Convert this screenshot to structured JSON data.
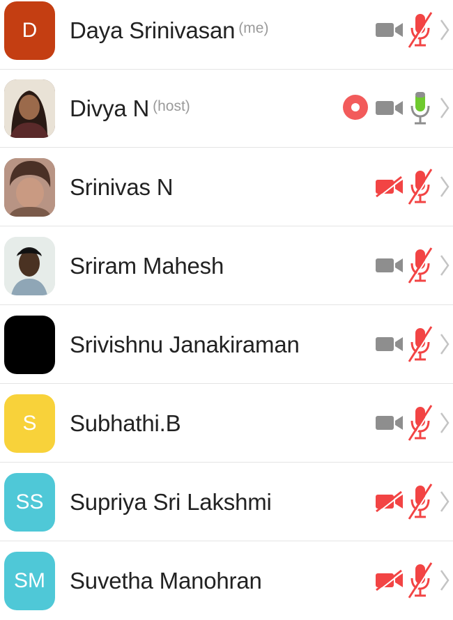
{
  "colors": {
    "muted_red": "#f24444",
    "active_green": "#6fca2e",
    "icon_gray": "#8e8e8e",
    "record_red": "#f25b5b",
    "chevron_gray": "#c4c4c4"
  },
  "participants": [
    {
      "name": "Daya Srinivasan",
      "role": "(me)",
      "avatar_initials": "D",
      "avatar_color": "#c43e12",
      "video": "on",
      "audio": "muted",
      "recording": false
    },
    {
      "name": "Divya N",
      "role": "(host)",
      "avatar_initials": "",
      "avatar_color": "#6b4a3a",
      "video": "on",
      "audio": "active",
      "recording": true
    },
    {
      "name": "Srinivas N",
      "role": "",
      "avatar_initials": "",
      "avatar_color": "#8a6a5a",
      "video": "off",
      "audio": "muted",
      "recording": false
    },
    {
      "name": "Sriram Mahesh",
      "role": "",
      "avatar_initials": "",
      "avatar_color": "#d9dfe0",
      "video": "on",
      "audio": "muted",
      "recording": false
    },
    {
      "name": "Srivishnu Janakiraman",
      "role": "",
      "avatar_initials": "",
      "avatar_color": "#000000",
      "video": "on",
      "audio": "muted",
      "recording": false
    },
    {
      "name": "Subhathi.B",
      "role": "",
      "avatar_initials": "S",
      "avatar_color": "#f8d23a",
      "video": "on",
      "audio": "muted",
      "recording": false
    },
    {
      "name": "Supriya Sri Lakshmi",
      "role": "",
      "avatar_initials": "SS",
      "avatar_color": "#4fc8d7",
      "video": "off",
      "audio": "muted",
      "recording": false
    },
    {
      "name": "Suvetha Manohran",
      "role": "",
      "avatar_initials": "SM",
      "avatar_color": "#4fc8d7",
      "video": "off",
      "audio": "muted",
      "recording": false
    }
  ]
}
